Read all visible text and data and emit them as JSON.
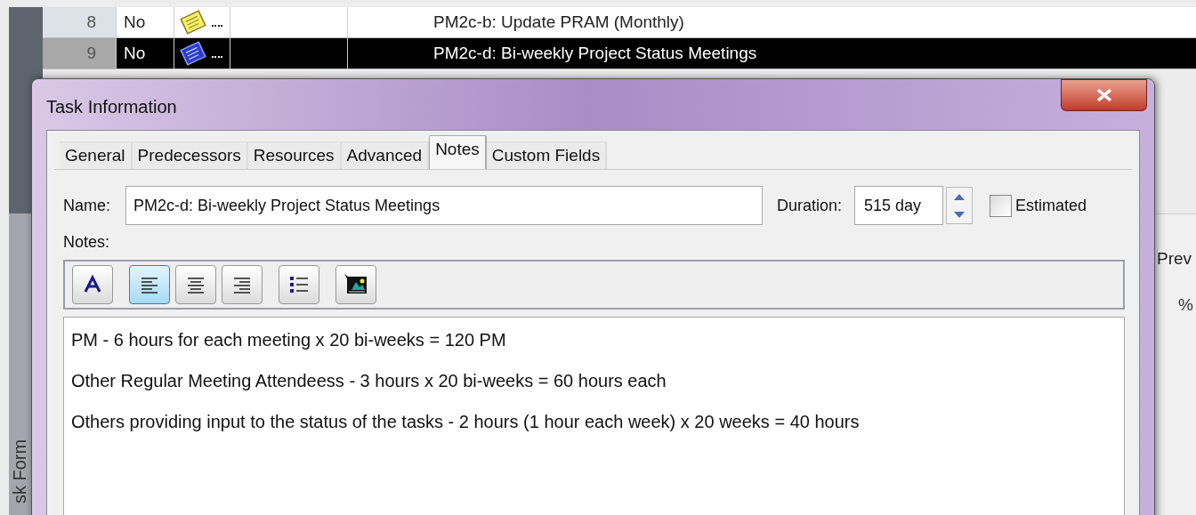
{
  "table": {
    "rows": [
      {
        "id": "8",
        "column_2": "No",
        "name": "PM2c-b: Update PRAM (Monthly)",
        "selected": false
      },
      {
        "id": "9",
        "column_2": "No",
        "name": "PM2c-d: Bi-weekly Project Status Meetings",
        "selected": true
      }
    ]
  },
  "side_panel": {
    "button": "Prev",
    "column_label": "%",
    "vertical_label": "sk Form"
  },
  "dialog": {
    "title": "Task Information",
    "tabs": [
      {
        "label": "General",
        "selected": false
      },
      {
        "label": "Predecessors",
        "selected": false
      },
      {
        "label": "Resources",
        "selected": false
      },
      {
        "label": "Advanced",
        "selected": false
      },
      {
        "label": "Notes",
        "selected": true
      },
      {
        "label": "Custom Fields",
        "selected": false
      }
    ],
    "name_label": "Name:",
    "name_value": "PM2c-d: Bi-weekly Project Status Meetings",
    "duration_label": "Duration:",
    "duration_value": "515 day",
    "estimated": {
      "label": "Estimated",
      "checked": false
    },
    "notes_label": "Notes:",
    "toolbar": [
      {
        "kind": "font",
        "pressed": false
      },
      {
        "kind": "align-left",
        "pressed": true
      },
      {
        "kind": "align-center",
        "pressed": false
      },
      {
        "kind": "align-right",
        "pressed": false
      },
      {
        "kind": "bullets",
        "pressed": false
      },
      {
        "kind": "object",
        "pressed": false
      }
    ],
    "notes": [
      "PM - 6 hours for each meeting x 20 bi-weeks = 120 PM",
      "Other Regular Meeting Attendeess - 3 hours x 20 bi-weeks = 60 hours each",
      "Others providing input to the status of the tasks - 2 hours (1 hour each week) x 20 weeks = 40 hours"
    ]
  }
}
